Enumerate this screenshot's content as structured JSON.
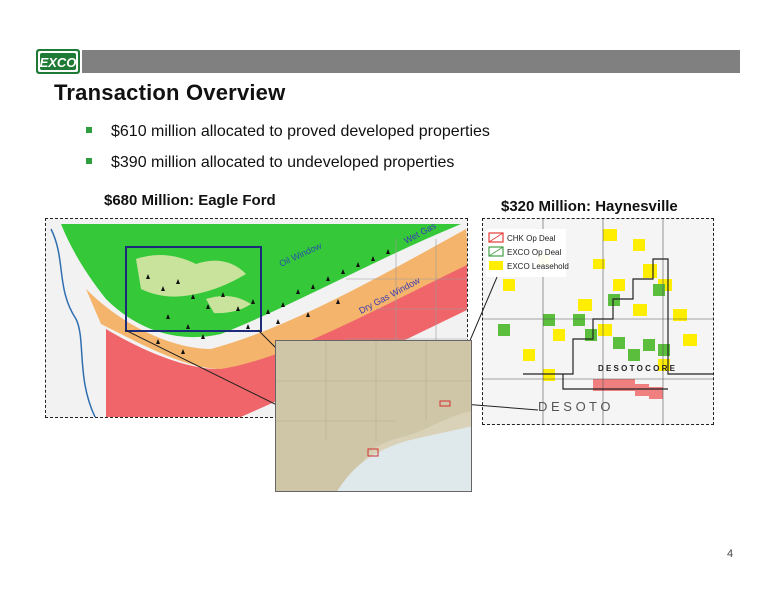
{
  "header": {
    "logo_text": "EXCO",
    "title": "Transaction Overview"
  },
  "bullets": [
    "$610 million allocated to proved developed properties",
    "$390 million allocated to undeveloped properties"
  ],
  "eagle_ford_map": {
    "caption": "$680 Million:  Eagle Ford",
    "window_labels": [
      "Oil Window",
      "Dry Gas Window",
      "Wet Gas"
    ]
  },
  "haynesville_map": {
    "caption": "$320 Million:  Haynesville",
    "legend": [
      {
        "label": "CHK Op Deal",
        "color": "#e53935"
      },
      {
        "label": "EXCO Op Deal",
        "color": "#43a047"
      },
      {
        "label": "EXCO Leasehold",
        "color": "#ffee00"
      }
    ],
    "core_label": "D E S O T O   C O R E",
    "parish_label": "D E   S O T O"
  },
  "page_number": "4"
}
